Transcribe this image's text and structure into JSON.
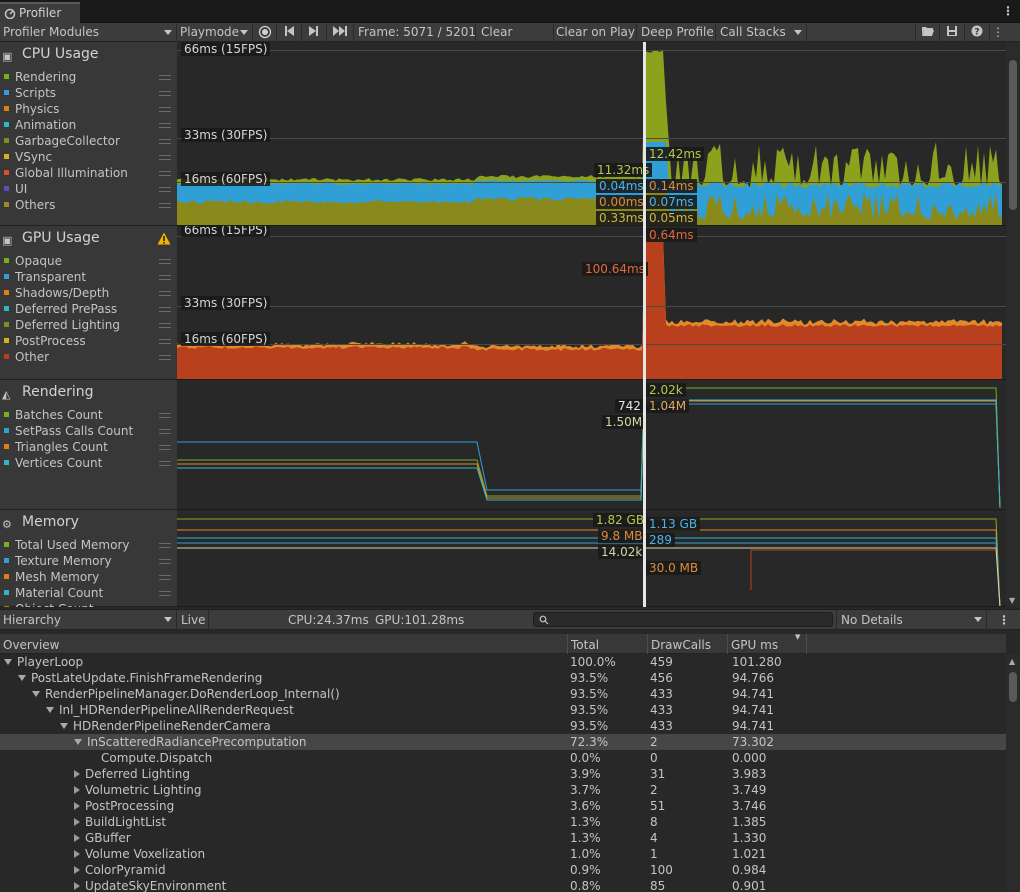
{
  "window": {
    "tab_title": "Profiler"
  },
  "toolbar": {
    "modules_dropdown": "Profiler Modules",
    "playmode": "Playmode",
    "frame": "Frame: 5071 / 5201",
    "clear": "Clear",
    "clear_on_play": "Clear on Play",
    "deep_profile": "Deep Profile",
    "call_stacks": "Call Stacks"
  },
  "modules": [
    {
      "title": "CPU Usage",
      "icon": "cpu-icon",
      "legend": [
        {
          "label": "Rendering",
          "color": "#7cad1e"
        },
        {
          "label": "Scripts",
          "color": "#2f9fd6"
        },
        {
          "label": "Physics",
          "color": "#e57c1b"
        },
        {
          "label": "Animation",
          "color": "#36b3c9"
        },
        {
          "label": "GarbageCollector",
          "color": "#8a8a1c"
        },
        {
          "label": "VSync",
          "color": "#d6b11c"
        },
        {
          "label": "Global Illumination",
          "color": "#d6502a"
        },
        {
          "label": "UI",
          "color": "#6b45c4"
        },
        {
          "label": "Others",
          "color": "#9a8a2a"
        }
      ]
    },
    {
      "title": "GPU Usage",
      "icon": "gpu-icon",
      "warning": true,
      "legend": [
        {
          "label": "Opaque",
          "color": "#7cad1e"
        },
        {
          "label": "Transparent",
          "color": "#2f9fd6"
        },
        {
          "label": "Shadows/Depth",
          "color": "#e57c1b"
        },
        {
          "label": "Deferred PrePass",
          "color": "#36b3c9"
        },
        {
          "label": "Deferred Lighting",
          "color": "#8a8a1c"
        },
        {
          "label": "PostProcess",
          "color": "#d6b11c"
        },
        {
          "label": "Other",
          "color": "#b8401c"
        }
      ]
    },
    {
      "title": "Rendering",
      "icon": "rendering-icon",
      "legend": [
        {
          "label": "Batches Count",
          "color": "#7cad1e"
        },
        {
          "label": "SetPass Calls Count",
          "color": "#2f9fd6"
        },
        {
          "label": "Triangles Count",
          "color": "#e57c1b"
        },
        {
          "label": "Vertices Count",
          "color": "#36b3c9"
        }
      ]
    },
    {
      "title": "Memory",
      "icon": "memory-icon",
      "legend": [
        {
          "label": "Total Used Memory",
          "color": "#7cad1e"
        },
        {
          "label": "Texture Memory",
          "color": "#2f9fd6"
        },
        {
          "label": "Mesh Memory",
          "color": "#e57c1b"
        },
        {
          "label": "Material Count",
          "color": "#36b3c9"
        },
        {
          "label": "Object Count",
          "color": "#8a8a1c"
        }
      ]
    }
  ],
  "charts": {
    "cpu": {
      "gridlines": [
        "66ms (15FPS)",
        "33ms (30FPS)",
        "16ms (60FPS)"
      ],
      "left_values": [
        "11.32ms",
        "0.04ms",
        "0.00ms",
        "0.33ms"
      ],
      "right_values": [
        "12.42ms",
        "0.14ms",
        "0.07ms",
        "0.05ms"
      ]
    },
    "gpu": {
      "gridlines": [
        "66ms (15FPS)",
        "33ms (30FPS)",
        "16ms (60FPS)"
      ],
      "left_value": "100.64ms",
      "right_value": "0.64ms"
    },
    "rendering": {
      "left_values": [
        "742",
        "1.50M"
      ],
      "right_values": [
        "2.02k",
        "1.04M"
      ]
    },
    "memory": {
      "left_values": [
        "1.82 GB",
        "9.8 MB",
        "14.02k"
      ],
      "right_values": [
        "1.13 GB",
        "289",
        "30.0 MB"
      ]
    }
  },
  "details": {
    "view": "Hierarchy",
    "live": "Live",
    "cpu": "CPU:24.37ms",
    "gpu": "GPU:101.28ms",
    "search_placeholder": "",
    "no_details": "No Details"
  },
  "hierarchy": {
    "columns": [
      "Overview",
      "Total",
      "DrawCalls",
      "GPU ms"
    ],
    "rows": [
      {
        "name": "PlayerLoop",
        "depth": 0,
        "expander": "down",
        "total": "100.0%",
        "draw": "459",
        "gpu": "101.280"
      },
      {
        "name": "PostLateUpdate.FinishFrameRendering",
        "depth": 1,
        "expander": "down",
        "total": "93.5%",
        "draw": "456",
        "gpu": "94.766"
      },
      {
        "name": "RenderPipelineManager.DoRenderLoop_Internal()",
        "depth": 2,
        "expander": "down",
        "total": "93.5%",
        "draw": "433",
        "gpu": "94.741"
      },
      {
        "name": "Inl_HDRenderPipelineAllRenderRequest",
        "depth": 3,
        "expander": "down",
        "total": "93.5%",
        "draw": "433",
        "gpu": "94.741"
      },
      {
        "name": "HDRenderPipelineRenderCamera",
        "depth": 4,
        "expander": "down",
        "total": "93.5%",
        "draw": "433",
        "gpu": "94.741"
      },
      {
        "name": "InScatteredRadiancePrecomputation",
        "depth": 5,
        "expander": "down",
        "total": "72.3%",
        "draw": "2",
        "gpu": "73.302",
        "selected": true
      },
      {
        "name": "Compute.Dispatch",
        "depth": 6,
        "expander": "none",
        "total": "0.0%",
        "draw": "0",
        "gpu": "0.000"
      },
      {
        "name": "Deferred Lighting",
        "depth": 5,
        "expander": "right",
        "total": "3.9%",
        "draw": "31",
        "gpu": "3.983"
      },
      {
        "name": "Volumetric Lighting",
        "depth": 5,
        "expander": "right",
        "total": "3.7%",
        "draw": "2",
        "gpu": "3.749"
      },
      {
        "name": "PostProcessing",
        "depth": 5,
        "expander": "right",
        "total": "3.6%",
        "draw": "51",
        "gpu": "3.746"
      },
      {
        "name": "BuildLightList",
        "depth": 5,
        "expander": "right",
        "total": "1.3%",
        "draw": "8",
        "gpu": "1.385"
      },
      {
        "name": "GBuffer",
        "depth": 5,
        "expander": "right",
        "total": "1.3%",
        "draw": "4",
        "gpu": "1.330"
      },
      {
        "name": "Volume Voxelization",
        "depth": 5,
        "expander": "right",
        "total": "1.0%",
        "draw": "1",
        "gpu": "1.021"
      },
      {
        "name": "ColorPyramid",
        "depth": 5,
        "expander": "right",
        "total": "0.9%",
        "draw": "100",
        "gpu": "0.984"
      },
      {
        "name": "UpdateSkyEnvironment",
        "depth": 5,
        "expander": "right",
        "total": "0.8%",
        "draw": "85",
        "gpu": "0.901"
      }
    ]
  }
}
